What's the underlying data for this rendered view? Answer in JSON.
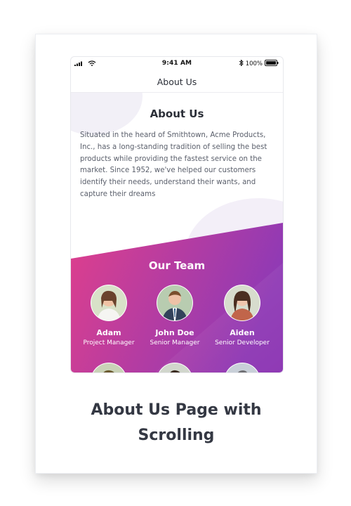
{
  "status_bar": {
    "time": "9:41 AM",
    "battery": "100%"
  },
  "phone_header": {
    "title": "About Us"
  },
  "about": {
    "title": "About Us",
    "text": "Situated in the heard of Smithtown, Acme Products, Inc., has a long-standing tradition of selling the best products while providing the fastest service on the market. Since 1952, we've helped our customers identify their needs, understand their wants, and capture their dreams"
  },
  "team": {
    "title": "Our Team",
    "members": [
      {
        "name": "Adam",
        "role": "Project Manager"
      },
      {
        "name": "John Doe",
        "role": "Senior Manager"
      },
      {
        "name": "Aiden",
        "role": "Senior Developer"
      }
    ]
  },
  "caption": {
    "line1": "About Us Page with",
    "line2": "Scrolling"
  },
  "colors": {
    "gradient_start": "#e0408f",
    "gradient_end": "#8f3ab5",
    "text_dark": "#2b2f38",
    "text_body": "#5a5f6b"
  },
  "icons": {
    "signal": "signal-icon",
    "wifi": "wifi-icon",
    "bluetooth": "bluetooth-icon",
    "battery": "battery-icon"
  }
}
